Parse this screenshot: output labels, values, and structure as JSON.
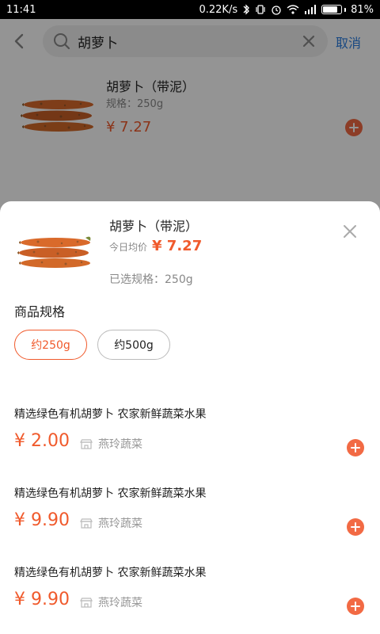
{
  "status_bar": {
    "time": "11:41",
    "net_speed": "0.22K/s",
    "battery": "81%",
    "battery_level": 0.81
  },
  "search": {
    "query": "胡萝卜",
    "cancel_label": "取消"
  },
  "result": {
    "title": "胡萝卜（带泥）",
    "spec": "规格：250g",
    "price": "¥ 7.27"
  },
  "sheet": {
    "title": "胡萝卜（带泥）",
    "price_label": "今日均价",
    "price": "¥ 7.27",
    "selected_spec": "已选规格：250g",
    "spec_section_title": "商品规格",
    "spec_options": [
      {
        "label": "约250g",
        "selected": true
      },
      {
        "label": "约500g",
        "selected": false
      }
    ]
  },
  "products": [
    {
      "name": "精选绿色有机胡萝卜 农家新鲜蔬菜水果",
      "price": "¥ 2.00",
      "store": "燕玲蔬菜"
    },
    {
      "name": "精选绿色有机胡萝卜 农家新鲜蔬菜水果",
      "price": "¥ 9.90",
      "store": "燕玲蔬菜"
    },
    {
      "name": "精选绿色有机胡萝卜 农家新鲜蔬菜水果",
      "price": "¥ 9.90",
      "store": "燕玲蔬菜"
    }
  ],
  "colors": {
    "accent": "#f05a2c",
    "link": "#2a7de1"
  },
  "icons": {
    "back": "chevron-left-icon",
    "search": "search-icon",
    "clear": "close-icon",
    "close": "close-icon",
    "add": "plus-circle-icon",
    "store": "store-icon"
  }
}
